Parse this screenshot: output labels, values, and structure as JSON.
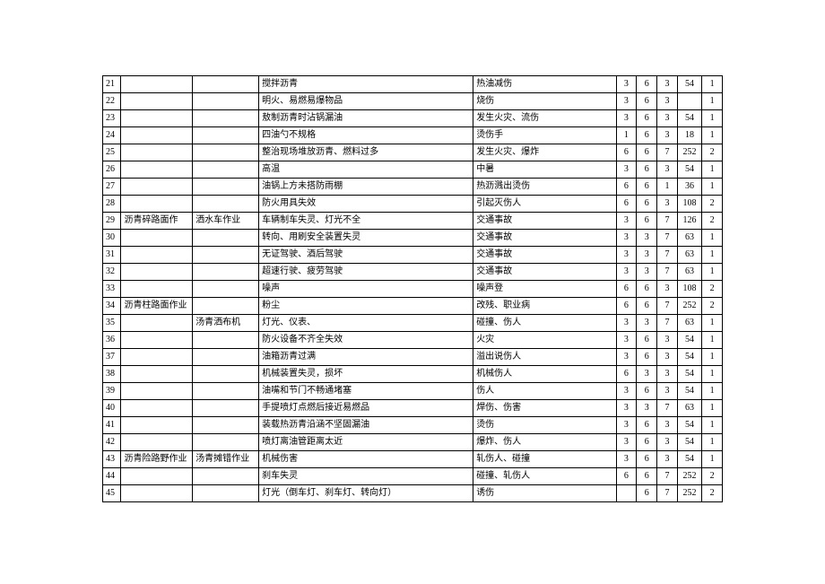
{
  "rows": [
    {
      "idx": "21",
      "cat1": "",
      "cat2": "",
      "hazard": "搅拌沥青",
      "result": "热油减伤",
      "n1": "3",
      "n2": "6",
      "n3": "3",
      "n4": "54",
      "n5": "1"
    },
    {
      "idx": "22",
      "cat1": "",
      "cat2": "",
      "hazard": "明火、易燃易爆物品",
      "result": "烧伤",
      "n1": "3",
      "n2": "6",
      "n3": "3",
      "n4": "",
      "n5": "1"
    },
    {
      "idx": "23",
      "cat1": "",
      "cat2": "",
      "hazard": "敖制沥青时沾锅漏油",
      "result": "发生火灾、流伤",
      "n1": "3",
      "n2": "6",
      "n3": "3",
      "n4": "54",
      "n5": "1"
    },
    {
      "idx": "24",
      "cat1": "",
      "cat2": "",
      "hazard": "四油勺不规格",
      "result": "烫伤手",
      "n1": "1",
      "n2": "6",
      "n3": "3",
      "n4": "18",
      "n5": "1"
    },
    {
      "idx": "25",
      "cat1": "",
      "cat2": "",
      "hazard": "整治现场堆放沥青、燃料过多",
      "result": "发生火灾、爆炸",
      "n1": "6",
      "n2": "6",
      "n3": "7",
      "n4": "252",
      "n5": "2"
    },
    {
      "idx": "26",
      "cat1": "",
      "cat2": "",
      "hazard": "高温",
      "result": "中暑",
      "n1": "3",
      "n2": "6",
      "n3": "3",
      "n4": "54",
      "n5": "1"
    },
    {
      "idx": "27",
      "cat1": "",
      "cat2": "",
      "hazard": "油锅上方未搭防雨棚",
      "result": "热沥溅出烫伤",
      "n1": "6",
      "n2": "6",
      "n3": "1",
      "n4": "36",
      "n5": "1"
    },
    {
      "idx": "28",
      "cat1": "",
      "cat2": "",
      "hazard": "防火用具失效",
      "result": "引起灭伤人",
      "n1": "6",
      "n2": "6",
      "n3": "3",
      "n4": "108",
      "n5": "2"
    },
    {
      "idx": "29",
      "cat1": "沥青碎路面作",
      "cat2": "洒水车作业",
      "hazard": "车辆制车失灵、灯光不全",
      "result": "交通事故",
      "n1": "3",
      "n2": "6",
      "n3": "7",
      "n4": "126",
      "n5": "2"
    },
    {
      "idx": "30",
      "cat1": "",
      "cat2": "",
      "hazard": "转向、用刷安全装置失灵",
      "result": "交通事故",
      "n1": "3",
      "n2": "3",
      "n3": "7",
      "n4": "63",
      "n5": "1"
    },
    {
      "idx": "31",
      "cat1": "",
      "cat2": "",
      "hazard": "无证驾驶、酒后驾驶",
      "result": "交通事故",
      "n1": "3",
      "n2": "3",
      "n3": "7",
      "n4": "63",
      "n5": "1"
    },
    {
      "idx": "32",
      "cat1": "",
      "cat2": "",
      "hazard": "超速行驶、疲劳驾驶",
      "result": "交通事故",
      "n1": "3",
      "n2": "3",
      "n3": "7",
      "n4": "63",
      "n5": "1"
    },
    {
      "idx": "33",
      "cat1": "",
      "cat2": "",
      "hazard": "噪声",
      "result": "噪声登",
      "n1": "6",
      "n2": "6",
      "n3": "3",
      "n4": "108",
      "n5": "2"
    },
    {
      "idx": "34",
      "cat1": "沥青柱路面作业",
      "cat2": "",
      "hazard": "粉尘",
      "result": "改残、职业病",
      "n1": "6",
      "n2": "6",
      "n3": "7",
      "n4": "252",
      "n5": "2"
    },
    {
      "idx": "35",
      "cat1": "",
      "cat2": "汤青洒布机",
      "hazard": "灯光、仪表、",
      "result": "碰撞、伤人",
      "n1": "3",
      "n2": "3",
      "n3": "7",
      "n4": "63",
      "n5": "1"
    },
    {
      "idx": "36",
      "cat1": "",
      "cat2": "",
      "hazard": "防火设备不齐全失效",
      "result": "火灾",
      "n1": "3",
      "n2": "6",
      "n3": "3",
      "n4": "54",
      "n5": "1"
    },
    {
      "idx": "37",
      "cat1": "",
      "cat2": "",
      "hazard": "油箱沥青过满",
      "result": "溢出说伤人",
      "n1": "3",
      "n2": "6",
      "n3": "3",
      "n4": "54",
      "n5": "1"
    },
    {
      "idx": "38",
      "cat1": "",
      "cat2": "",
      "hazard": "机械装置失灵，损坏",
      "result": "机械伤人",
      "n1": "6",
      "n2": "3",
      "n3": "3",
      "n4": "54",
      "n5": "1"
    },
    {
      "idx": "39",
      "cat1": "",
      "cat2": "",
      "hazard": "油嘴和节门不畅通堵塞",
      "result": "伤人",
      "n1": "3",
      "n2": "6",
      "n3": "3",
      "n4": "54",
      "n5": "1"
    },
    {
      "idx": "40",
      "cat1": "",
      "cat2": "",
      "hazard": "手提喷灯点燃后接近易燃品",
      "result": "焊伤、伤害",
      "n1": "3",
      "n2": "3",
      "n3": "7",
      "n4": "63",
      "n5": "1"
    },
    {
      "idx": "41",
      "cat1": "",
      "cat2": "",
      "hazard": "装载热沥青沿涵不坚固漏油",
      "result": "烫伤",
      "n1": "3",
      "n2": "6",
      "n3": "3",
      "n4": "54",
      "n5": "1"
    },
    {
      "idx": "42",
      "cat1": "",
      "cat2": "",
      "hazard": "喷灯离油管距离太近",
      "result": "爆炸、伤人",
      "n1": "3",
      "n2": "6",
      "n3": "3",
      "n4": "54",
      "n5": "1"
    },
    {
      "idx": "43",
      "cat1": "沥青险路野作业",
      "cat2": "汤青摊错作业",
      "hazard": "机械伤害",
      "result": "轧伤人、碰撞",
      "n1": "3",
      "n2": "6",
      "n3": "3",
      "n4": "54",
      "n5": "1"
    },
    {
      "idx": "44",
      "cat1": "",
      "cat2": "",
      "hazard": "刹车失灵",
      "result": "碰撞、轧伤人",
      "n1": "6",
      "n2": "6",
      "n3": "7",
      "n4": "252",
      "n5": "2"
    },
    {
      "idx": "45",
      "cat1": "",
      "cat2": "",
      "hazard": "灯光（倒车灯、刹车灯、转向灯）",
      "result": "诱伤",
      "n1": "",
      "n2": "6",
      "n3": "7",
      "n4": "252",
      "n5": "2"
    }
  ]
}
